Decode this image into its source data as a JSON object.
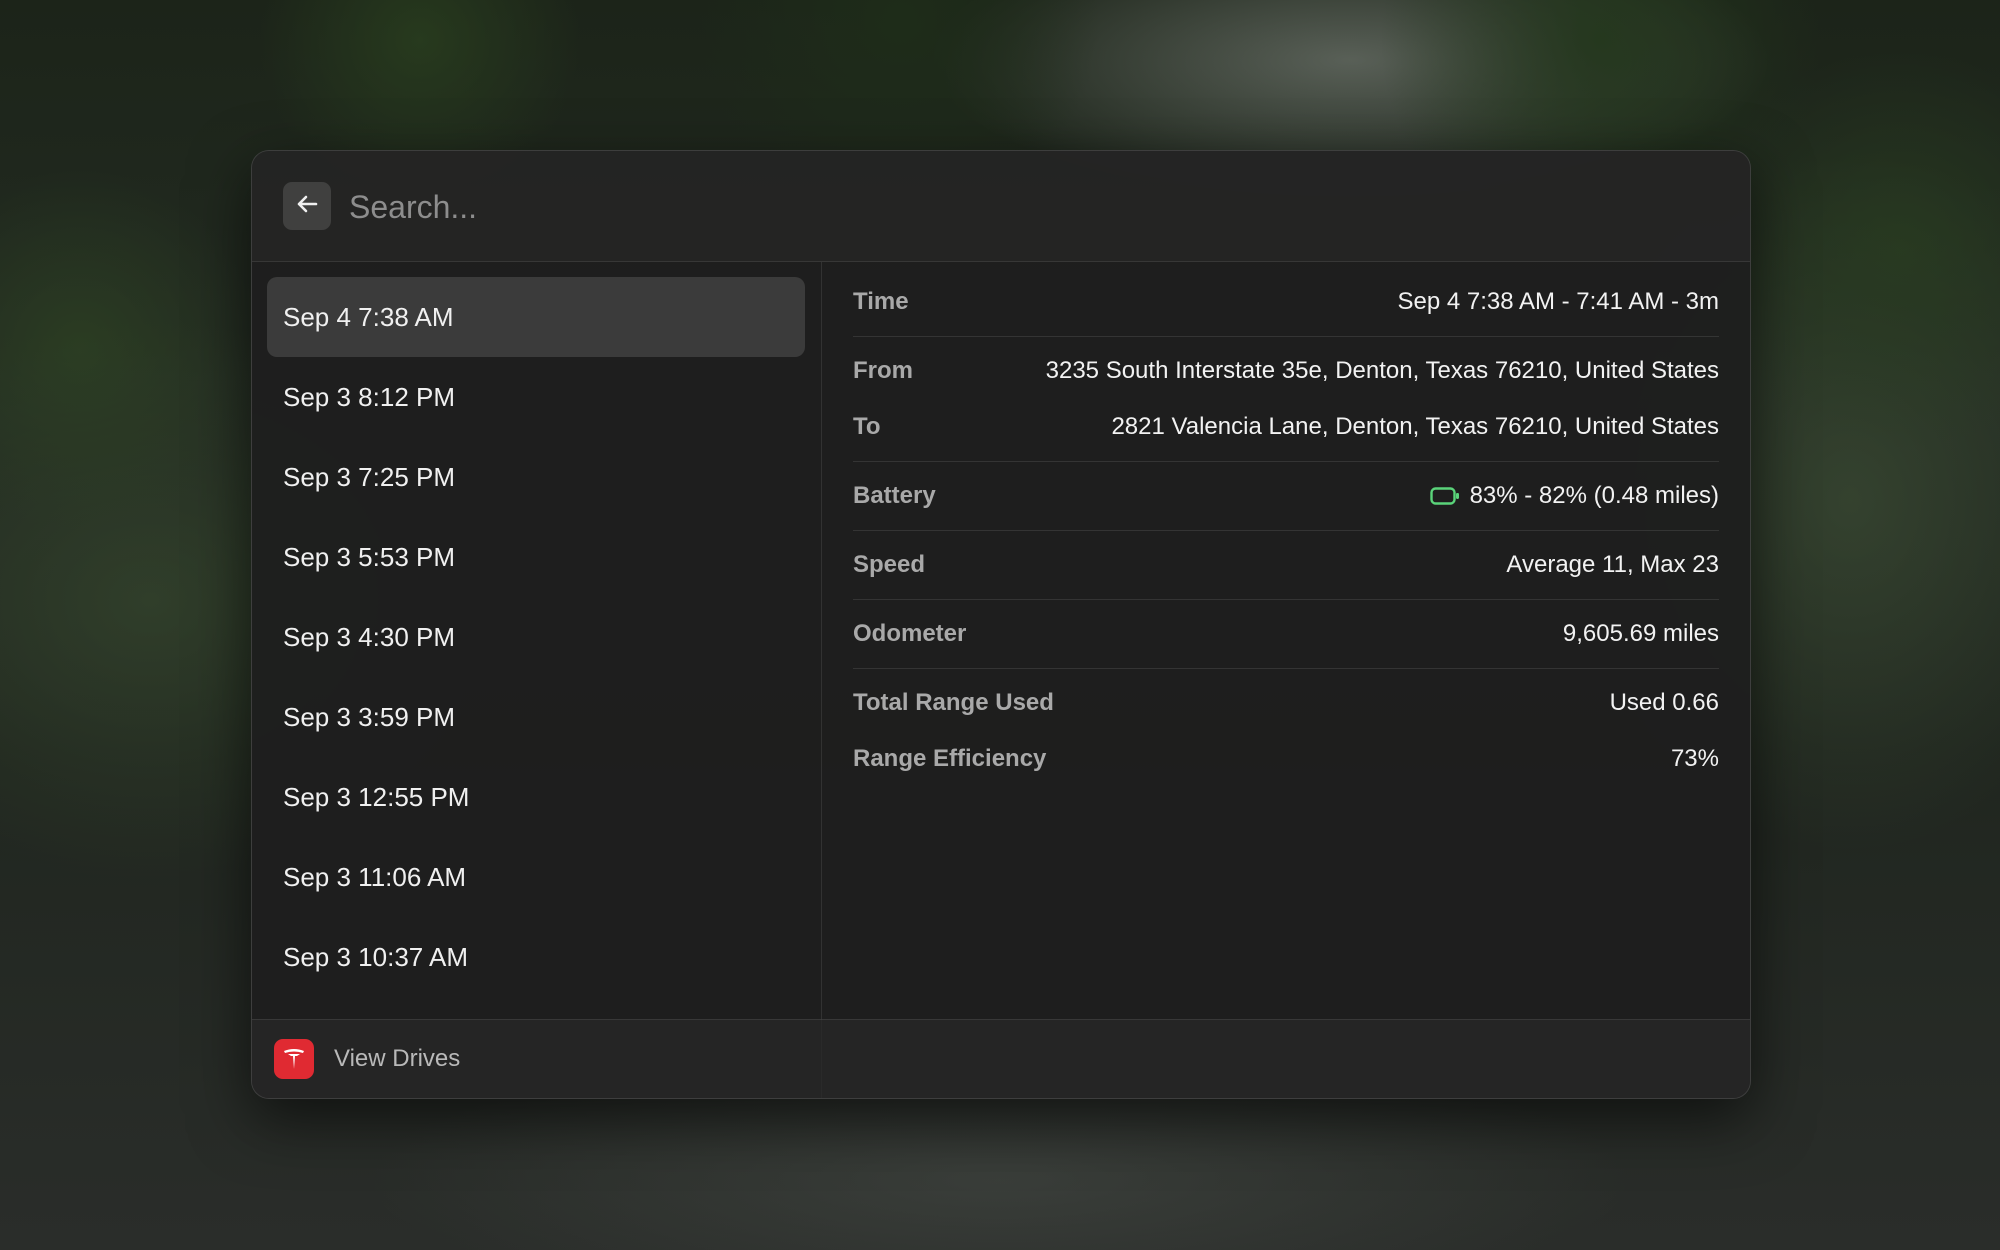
{
  "search": {
    "placeholder": "Search..."
  },
  "drives": [
    {
      "label": "Sep 4 7:38 AM",
      "selected": true
    },
    {
      "label": "Sep 3 8:12 PM"
    },
    {
      "label": "Sep 3 7:25 PM"
    },
    {
      "label": "Sep 3 5:53 PM"
    },
    {
      "label": "Sep 3 4:30 PM"
    },
    {
      "label": "Sep 3 3:59 PM"
    },
    {
      "label": "Sep 3 12:55 PM"
    },
    {
      "label": "Sep 3 11:06 AM"
    },
    {
      "label": "Sep 3 10:37 AM"
    }
  ],
  "detail": {
    "time": {
      "label": "Time",
      "value": "Sep 4 7:38 AM - 7:41 AM - 3m"
    },
    "from": {
      "label": "From",
      "value": "3235 South Interstate 35e, Denton, Texas 76210, United States"
    },
    "to": {
      "label": "To",
      "value": "2821 Valencia Lane, Denton, Texas 76210, United States"
    },
    "battery": {
      "label": "Battery",
      "value": "83% - 82% (0.48 miles)",
      "icon": "battery-icon",
      "icon_color": "#5ad47a"
    },
    "speed": {
      "label": "Speed",
      "value": "Average 11, Max 23"
    },
    "odometer": {
      "label": "Odometer",
      "value": "9,605.69 miles"
    },
    "range_used": {
      "label": "Total Range Used",
      "value": "Used 0.66"
    },
    "range_efficiency": {
      "label": "Range Efficiency",
      "value": "73%"
    }
  },
  "footer": {
    "app_icon": "tesla-logo-icon",
    "app_icon_color": "#e02a32",
    "action_label": "View Drives"
  }
}
